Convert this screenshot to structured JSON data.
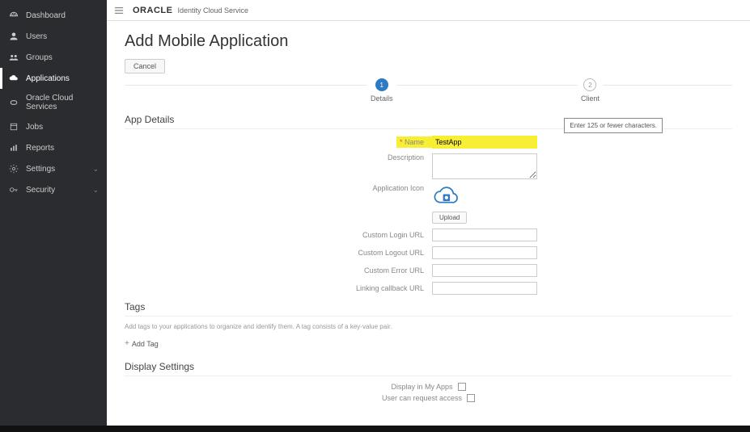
{
  "sidebar": {
    "items": [
      {
        "icon": "dashboard",
        "label": "Dashboard"
      },
      {
        "icon": "users",
        "label": "Users"
      },
      {
        "icon": "groups",
        "label": "Groups"
      },
      {
        "icon": "applications",
        "label": "Applications"
      },
      {
        "icon": "cloud",
        "label": "Oracle Cloud Services"
      },
      {
        "icon": "jobs",
        "label": "Jobs"
      },
      {
        "icon": "reports",
        "label": "Reports"
      },
      {
        "icon": "settings",
        "label": "Settings"
      },
      {
        "icon": "security",
        "label": "Security"
      }
    ]
  },
  "header": {
    "brand": "ORACLE",
    "product": "Identity Cloud Service"
  },
  "page": {
    "title": "Add Mobile Application",
    "cancel_label": "Cancel"
  },
  "stepper": {
    "step1": {
      "num": "1",
      "label": "Details"
    },
    "step2": {
      "num": "2",
      "label": "Client"
    }
  },
  "tooltip": {
    "text": "Enter 125 or fewer characters."
  },
  "sections": {
    "app_details": "App Details",
    "tags": "Tags",
    "display_settings": "Display Settings"
  },
  "form": {
    "name_label": "Name",
    "name_value": "TestApp",
    "description_label": "Description",
    "description_value": "",
    "app_icon_label": "Application Icon",
    "upload_label": "Upload",
    "custom_login_label": "Custom Login URL",
    "custom_login_value": "",
    "custom_logout_label": "Custom Logout URL",
    "custom_logout_value": "",
    "custom_error_label": "Custom Error URL",
    "custom_error_value": "",
    "linking_callback_label": "Linking callback URL",
    "linking_callback_value": ""
  },
  "tags": {
    "desc": "Add tags to your applications to organize and identify them. A tag consists of a key-value pair.",
    "add_label": "Add Tag"
  },
  "display": {
    "in_my_apps_label": "Display in My Apps",
    "user_request_label": "User can request access"
  }
}
